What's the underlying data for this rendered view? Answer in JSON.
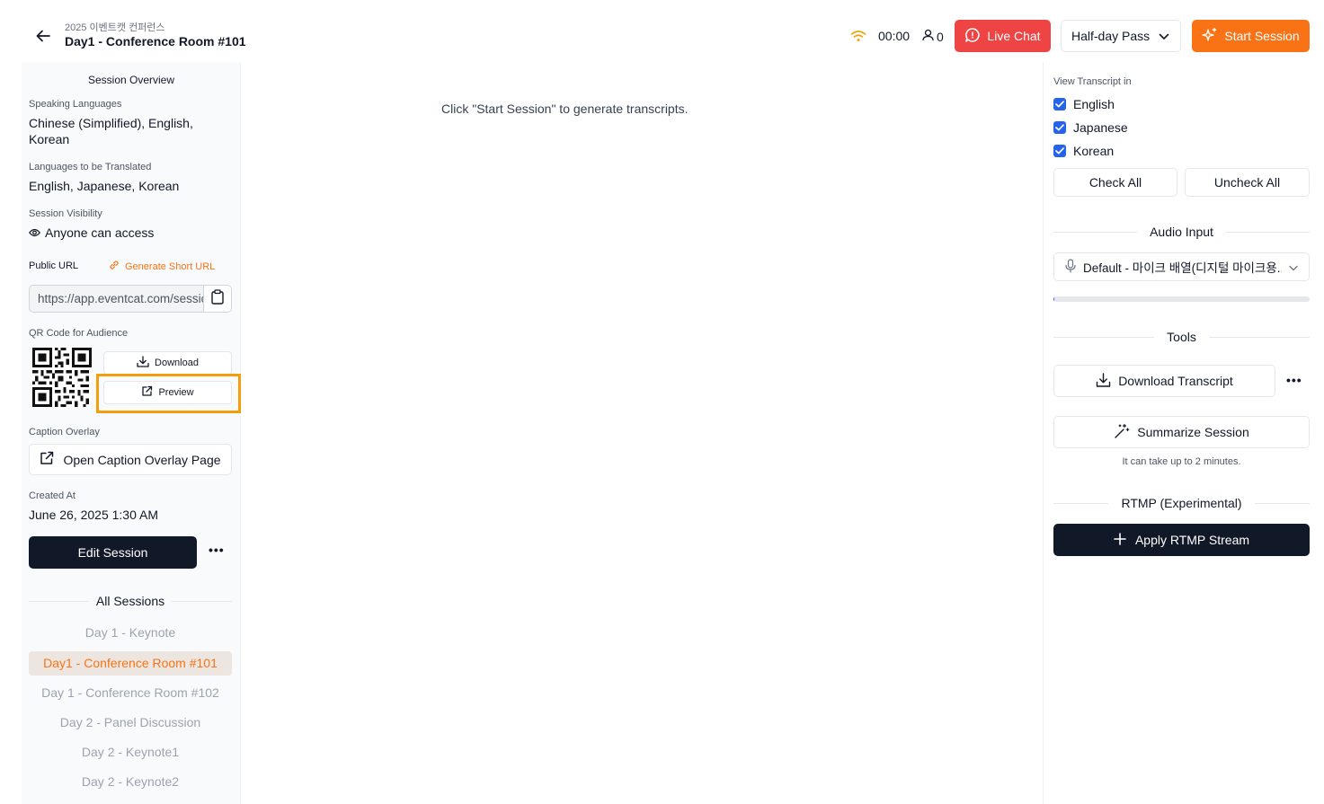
{
  "header": {
    "event_name": "2025 이벤트캣 컨퍼런스",
    "title": "Day1 - Conference Room #101",
    "timer": "00:00",
    "user_count": "0",
    "live_chat_label": "Live Chat",
    "pass_select": "Half-day Pass",
    "start_session_label": "Start Session"
  },
  "overview": {
    "title": "Session Overview",
    "speaking_languages_label": "Speaking Languages",
    "speaking_languages": "Chinese (Simplified), English, Korean",
    "translated_label": "Languages to be Translated",
    "translated": "English, Japanese, Korean",
    "visibility_label": "Session Visibility",
    "visibility": "Anyone can access",
    "public_url_label": "Public URL",
    "generate_short_url": "Generate Short URL",
    "public_url": "https://app.eventcat.com/session/",
    "qr_label": "QR Code for Audience",
    "download_label": "Download",
    "preview_label": "Preview",
    "caption_overlay_label": "Caption Overlay",
    "open_overlay_label": "Open Caption Overlay Page",
    "created_at_label": "Created At",
    "created_at": "June 26, 2025 1:30 AM",
    "edit_session_label": "Edit Session",
    "all_sessions_label": "All Sessions",
    "sessions": [
      "Day 1 - Keynote",
      "Day1 - Conference Room #101",
      "Day 1 - Conference Room #102",
      "Day 2 - Panel Discussion",
      "Day 2 - Keynote1",
      "Day 2 - Keynote2"
    ],
    "active_session_index": 1
  },
  "main": {
    "empty_message": "Click \"Start Session\" to generate transcripts."
  },
  "right": {
    "view_transcript_label": "View Transcript in",
    "languages": [
      {
        "label": "English",
        "checked": true
      },
      {
        "label": "Japanese",
        "checked": true
      },
      {
        "label": "Korean",
        "checked": true
      }
    ],
    "check_all": "Check All",
    "uncheck_all": "Uncheck All",
    "audio_input_title": "Audio Input",
    "audio_device": "Default - 마이크 배열(디지털 마이크용...",
    "audio_level": 0.005,
    "tools_title": "Tools",
    "download_transcript": "Download Transcript",
    "summarize_session": "Summarize Session",
    "summarize_hint": "It can take up to 2 minutes.",
    "rtmp_title": "RTMP (Experimental)",
    "apply_rtmp": "Apply RTMP Stream"
  },
  "colors": {
    "accent_orange": "#f97316",
    "live_red": "#ef4444",
    "dark": "#111827",
    "checkbox_blue": "#2563eb",
    "highlight": "#f59e0b"
  }
}
